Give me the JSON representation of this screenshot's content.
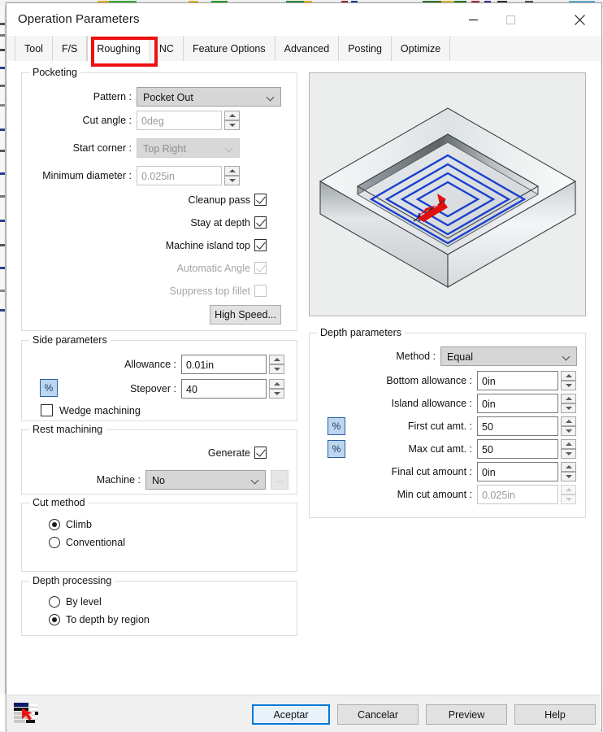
{
  "window": {
    "title": "Operation Parameters",
    "controls": {
      "minimize": "minimize-button",
      "maximize": "maximize-button",
      "close": "close-button"
    }
  },
  "tabs": [
    {
      "label": "Tool",
      "active": false
    },
    {
      "label": "F/S",
      "active": false
    },
    {
      "label": "Roughing",
      "active": true
    },
    {
      "label": "NC",
      "active": false
    },
    {
      "label": "Feature Options",
      "active": false
    },
    {
      "label": "Advanced",
      "active": false
    },
    {
      "label": "Posting",
      "active": false
    },
    {
      "label": "Optimize",
      "active": false
    }
  ],
  "highlight": {
    "color": "#ee1111",
    "target": "Roughing"
  },
  "pocketing": {
    "legend": "Pocketing",
    "pattern_label": "Pattern :",
    "pattern_value": "Pocket Out",
    "cut_angle_label": "Cut angle :",
    "cut_angle_value": "0deg",
    "start_corner_label": "Start corner :",
    "start_corner_value": "Top Right",
    "minimum_diameter_label": "Minimum diameter :",
    "minimum_diameter_value": "0.025in",
    "cleanup_pass_label": "Cleanup pass",
    "stay_at_depth_label": "Stay at depth",
    "machine_island_top_label": "Machine island top",
    "automatic_angle_label": "Automatic Angle",
    "suppress_top_fillet_label": "Suppress top fillet",
    "high_speed_label": "High Speed..."
  },
  "side_parameters": {
    "legend": "Side parameters",
    "allowance_label": "Allowance :",
    "allowance_value": "0.01in",
    "stepover_label": "Stepover :",
    "stepover_value": "40",
    "stepover_percent_label": "%",
    "wedge_machining_label": "Wedge machining"
  },
  "rest_machining": {
    "legend": "Rest machining",
    "generate_label": "Generate",
    "machine_label": "Machine :",
    "machine_value": "No",
    "browse_label": "..."
  },
  "cut_method": {
    "legend": "Cut method",
    "options": [
      "Climb",
      "Conventional"
    ],
    "selected": "Climb"
  },
  "depth_processing": {
    "legend": "Depth processing",
    "options": [
      "By level",
      "To depth by region"
    ],
    "selected": "To depth by region"
  },
  "depth_parameters": {
    "legend": "Depth parameters",
    "method_label": "Method :",
    "method_value": "Equal",
    "bottom_allowance_label": "Bottom allowance :",
    "bottom_allowance_value": "0in",
    "island_allowance_label": "Island allowance :",
    "island_allowance_value": "0in",
    "first_cut_label": "First cut amt. :",
    "first_cut_value": "50",
    "first_cut_percent_label": "%",
    "max_cut_label": "Max cut amt. :",
    "max_cut_value": "50",
    "max_cut_percent_label": "%",
    "final_cut_label": "Final cut amount :",
    "final_cut_value": "0in",
    "min_cut_label": "Min cut amount :",
    "min_cut_value": "0.025in"
  },
  "preview": {
    "name": "toolpath-preview",
    "description": "Isometric pocket with spiral toolpath",
    "toolpath_color": "#1a3fd0",
    "arrow_color": "#e01010"
  },
  "footer": {
    "accept_label": "Aceptar",
    "cancel_label": "Cancelar",
    "preview_label": "Preview",
    "help_label": "Help"
  }
}
